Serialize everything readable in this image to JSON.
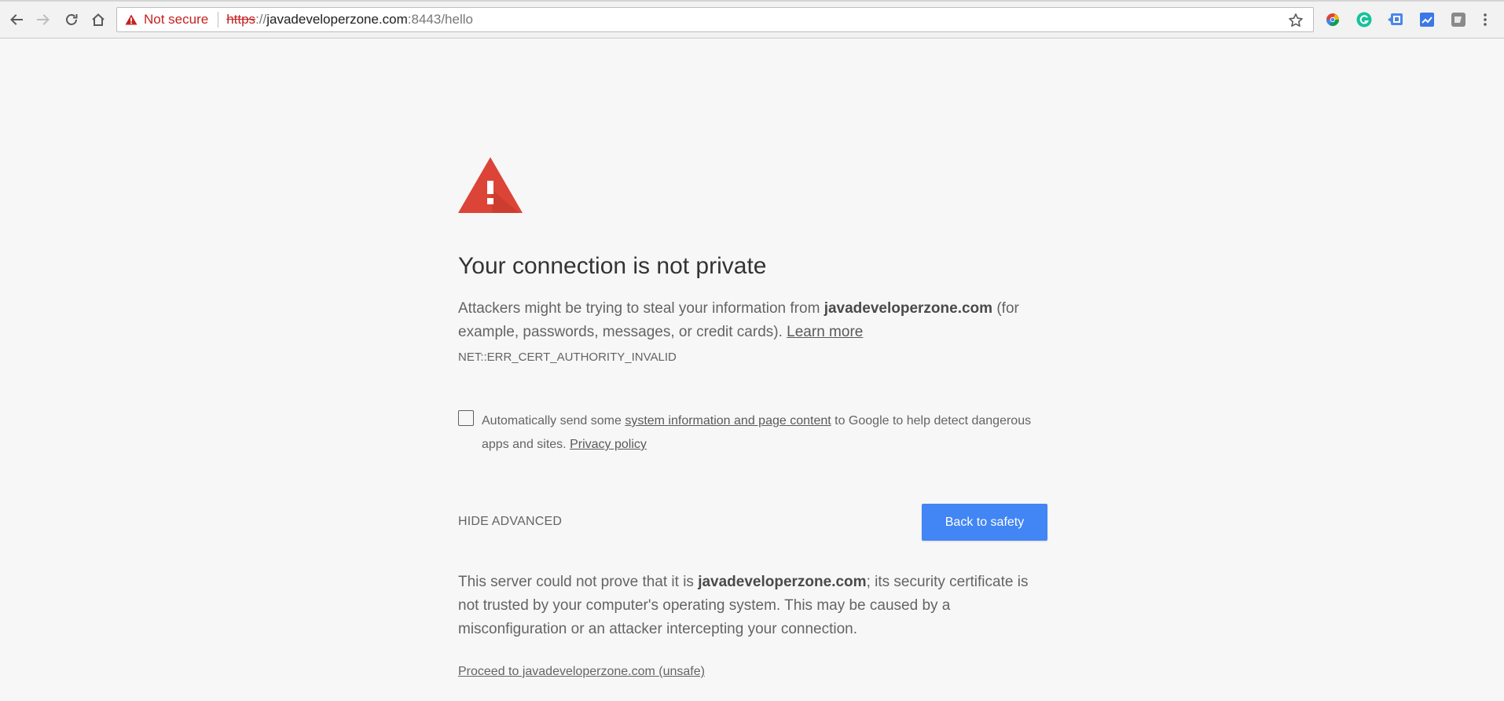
{
  "browser": {
    "security_label": "Not secure",
    "url": {
      "scheme": "https",
      "separator": "://",
      "host": "javadeveloperzone.com",
      "port_path": ":8443/hello"
    },
    "extensions": [
      "chrome-color-icon",
      "grammarly-icon",
      "calendar-ext-icon",
      "chart-ext-icon",
      "gray-ext-icon"
    ],
    "colors": {
      "warning_red": "#c5221f",
      "grammarly_green": "#15c39a",
      "ext_blue": "#4a86e8"
    }
  },
  "interstitial": {
    "icon": "warning-triangle-icon",
    "title": "Your connection is not private",
    "message_prefix": "Attackers might be trying to steal your information from ",
    "message_host": "javadeveloperzone.com",
    "message_suffix": " (for example, passwords, messages, or credit cards). ",
    "learn_more": "Learn more",
    "error_code": "NET::ERR_CERT_AUTHORITY_INVALID",
    "optin_prefix": "Automatically send some ",
    "optin_link": "system information and page content",
    "optin_suffix": " to Google to help detect dangerous apps and sites. ",
    "privacy_policy": "Privacy policy",
    "optin_checked": false,
    "hide_advanced": "HIDE ADVANCED",
    "back_button": "Back to safety",
    "details_prefix": "This server could not prove that it is ",
    "details_host": "javadeveloperzone.com",
    "details_suffix": "; its security certificate is not trusted by your computer's operating system. This may be caused by a misconfiguration or an attacker intercepting your connection.",
    "proceed_link": "Proceed to javadeveloperzone.com (unsafe)",
    "colors": {
      "triangle": "#db4437",
      "button": "#4285f4",
      "background": "#f7f7f7"
    }
  }
}
